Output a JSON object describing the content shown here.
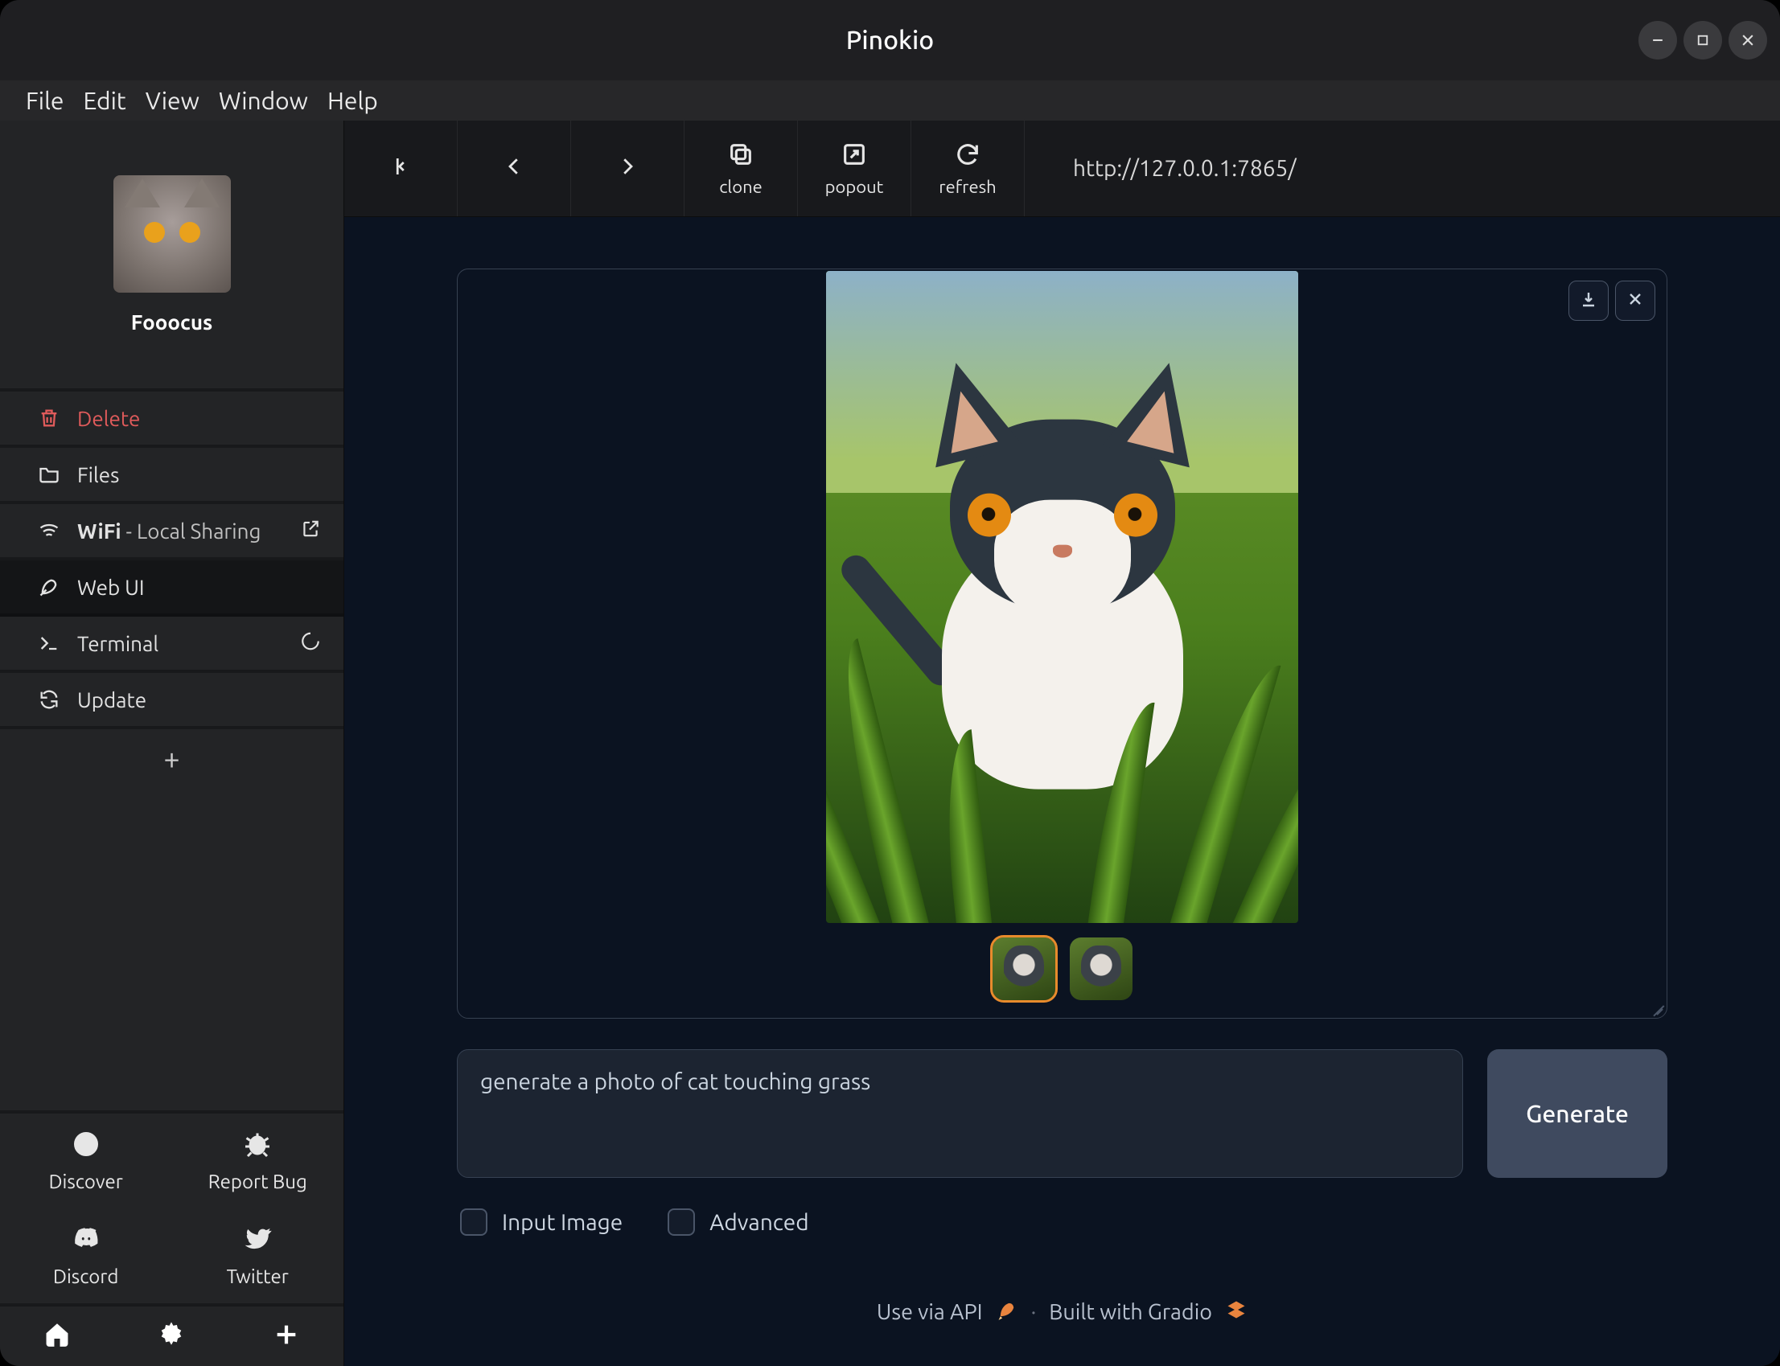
{
  "window": {
    "title": "Pinokio"
  },
  "menu": {
    "file": "File",
    "edit": "Edit",
    "view": "View",
    "window": "Window",
    "help": "Help"
  },
  "sidebar": {
    "app_name": "Fooocus",
    "items": {
      "delete": "Delete",
      "files": "Files",
      "wifi_label": "WiFi",
      "wifi_suffix": " - Local Sharing",
      "webui": "Web UI",
      "terminal": "Terminal",
      "update": "Update"
    },
    "grid": {
      "discover": "Discover",
      "report_bug": "Report Bug",
      "discord": "Discord",
      "twitter": "Twitter"
    }
  },
  "topbar": {
    "clone": "clone",
    "popout": "popout",
    "refresh": "refresh",
    "url": "http://127.0.0.1:7865/"
  },
  "viewer": {
    "prompt_value": "generate a photo of cat touching grass",
    "generate": "Generate",
    "check_input_image": "Input Image",
    "check_advanced": "Advanced",
    "footer_api": "Use via API",
    "footer_gradio": "Built with Gradio"
  }
}
